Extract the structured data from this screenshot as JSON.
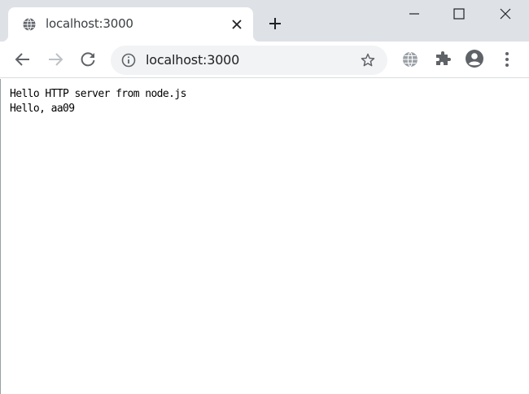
{
  "tab": {
    "title": "localhost:3000"
  },
  "address_bar": {
    "url": "localhost:3000"
  },
  "page": {
    "lines": [
      "Hello HTTP server from node.js",
      "Hello, aa09"
    ]
  },
  "colors": {
    "tabstrip_bg": "#dee1e6",
    "omnibox_bg": "#f1f3f4",
    "icon": "#5f6368"
  },
  "icons": {
    "tab_favicon": "globe-icon",
    "tab_close": "close-icon",
    "new_tab": "plus-icon",
    "back": "back-arrow-icon",
    "forward": "forward-arrow-icon",
    "reload": "reload-icon",
    "site_info": "info-icon",
    "bookmark": "star-icon",
    "extension_1": "globe-extension-icon",
    "extension_2": "puzzle-icon",
    "profile": "account-icon",
    "menu": "more-vert-icon",
    "minimize": "minimize-icon",
    "maximize": "maximize-icon",
    "close_window": "close-window-icon"
  }
}
